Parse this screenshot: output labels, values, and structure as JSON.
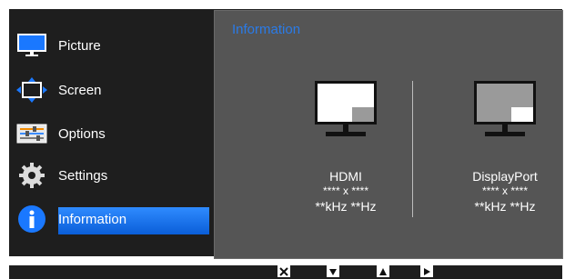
{
  "menu": {
    "items": [
      {
        "label": "Picture",
        "icon": "monitor-icon"
      },
      {
        "label": "Screen",
        "icon": "screen-adjust-icon"
      },
      {
        "label": "Options",
        "icon": "options-icon"
      },
      {
        "label": "Settings",
        "icon": "gear-icon"
      },
      {
        "label": "Information",
        "icon": "info-icon",
        "selected": true
      }
    ]
  },
  "panel": {
    "title": "Information",
    "ports": [
      {
        "name": "HDMI",
        "resolution": "**** x ****",
        "frequency": "**kHz **Hz"
      },
      {
        "name": "DisplayPort",
        "resolution": "**** x ****",
        "frequency": "**kHz **Hz"
      }
    ]
  },
  "controls": {
    "buttons": [
      "close-icon",
      "down-arrow-icon",
      "up-arrow-icon",
      "right-arrow-icon"
    ]
  },
  "colors": {
    "accent": "#0a5ed8",
    "title": "#2a7be8",
    "panel_bg": "#555555",
    "menu_bg": "#1e1e1e"
  }
}
